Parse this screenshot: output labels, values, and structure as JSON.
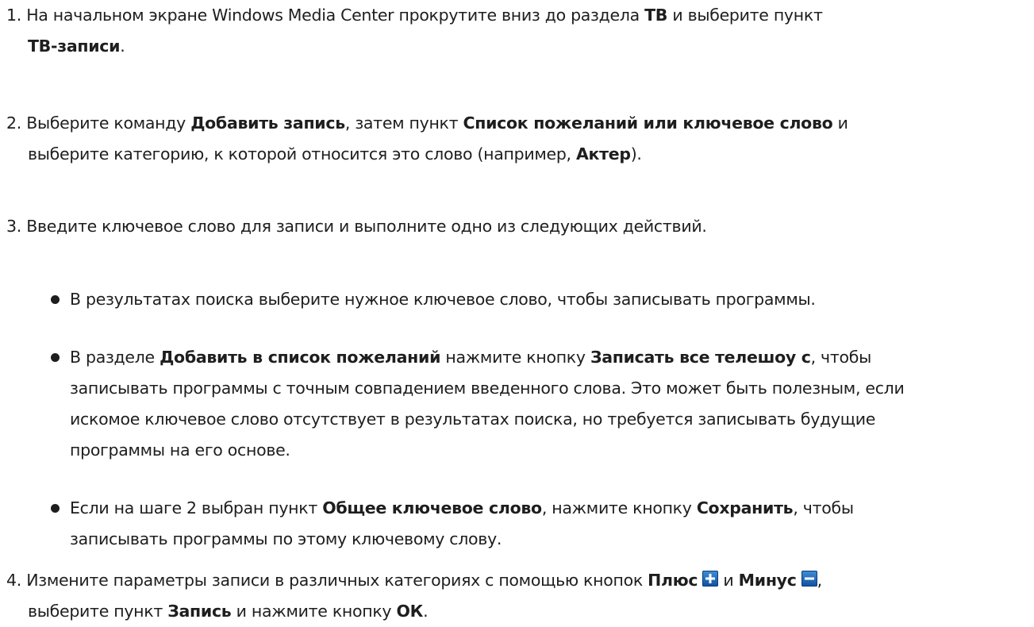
{
  "steps": [
    {
      "num": "1.",
      "parts": [
        {
          "t": "На начальном экране Windows Media Center прокрутите вниз до раздела ",
          "b": false
        },
        {
          "t": "ТВ",
          "b": true
        },
        {
          "t": " и выберите пункт",
          "b": false
        }
      ],
      "cont": [
        {
          "t": "ТВ-записи",
          "b": true
        },
        {
          "t": ".",
          "b": false
        }
      ]
    },
    {
      "num": "2.",
      "parts": [
        {
          "t": "Выберите команду ",
          "b": false
        },
        {
          "t": "Добавить запись",
          "b": true
        },
        {
          "t": ", затем пункт ",
          "b": false
        },
        {
          "t": "Список пожеланий или ключевое слово",
          "b": true
        },
        {
          "t": " и",
          "b": false
        }
      ],
      "cont": [
        {
          "t": "выберите категорию, к которой относится это слово (например, ",
          "b": false
        },
        {
          "t": "Актер",
          "b": true
        },
        {
          "t": ").",
          "b": false
        }
      ]
    },
    {
      "num": "3.",
      "parts": [
        {
          "t": "Введите ключевое слово для записи и выполните одно из следующих действий.",
          "b": false
        }
      ]
    },
    {
      "num": "4.",
      "parts": [
        {
          "t": "Измените параметры записи в различных категориях с помощью кнопок ",
          "b": false
        },
        {
          "t": "Плюс",
          "b": true
        }
      ],
      "parts_mid": [
        {
          "t": " и ",
          "b": false
        },
        {
          "t": "Минус",
          "b": true
        }
      ],
      "parts_end": [
        {
          "t": ",",
          "b": false
        }
      ],
      "cont": [
        {
          "t": "выберите пункт ",
          "b": false
        },
        {
          "t": "Запись",
          "b": true
        },
        {
          "t": " и нажмите кнопку ",
          "b": false
        },
        {
          "t": "ОК",
          "b": true
        },
        {
          "t": ".",
          "b": false
        }
      ]
    }
  ],
  "bullets": [
    {
      "lines": [
        [
          {
            "t": "В результатах поиска выберите нужное ключевое слово, чтобы записывать программы.",
            "b": false
          }
        ]
      ]
    },
    {
      "lines": [
        [
          {
            "t": "В разделе ",
            "b": false
          },
          {
            "t": "Добавить в список пожеланий",
            "b": true
          },
          {
            "t": " нажмите кнопку ",
            "b": false
          },
          {
            "t": "Записать все телешоу с",
            "b": true
          },
          {
            "t": ", чтобы",
            "b": false
          }
        ],
        [
          {
            "t": "записывать программы с точным совпадением введенного слова. Это может быть полезным, если",
            "b": false
          }
        ],
        [
          {
            "t": "искомое ключевое слово отсутствует в результатах поиска, но требуется записывать будущие",
            "b": false
          }
        ],
        [
          {
            "t": "программы на его основе.",
            "b": false
          }
        ]
      ]
    },
    {
      "lines": [
        [
          {
            "t": "Если на шаге 2 выбран пункт ",
            "b": false
          },
          {
            "t": "Общее ключевое слово",
            "b": true
          },
          {
            "t": ", нажмите кнопку ",
            "b": false
          },
          {
            "t": "Сохранить",
            "b": true
          },
          {
            "t": ", чтобы",
            "b": false
          }
        ],
        [
          {
            "t": "записывать программы по этому ключевому слову.",
            "b": false
          }
        ]
      ]
    }
  ],
  "icons": {
    "plus": "plus-button-icon",
    "minus": "minus-button-icon",
    "icon_color": "#1a63b8"
  }
}
